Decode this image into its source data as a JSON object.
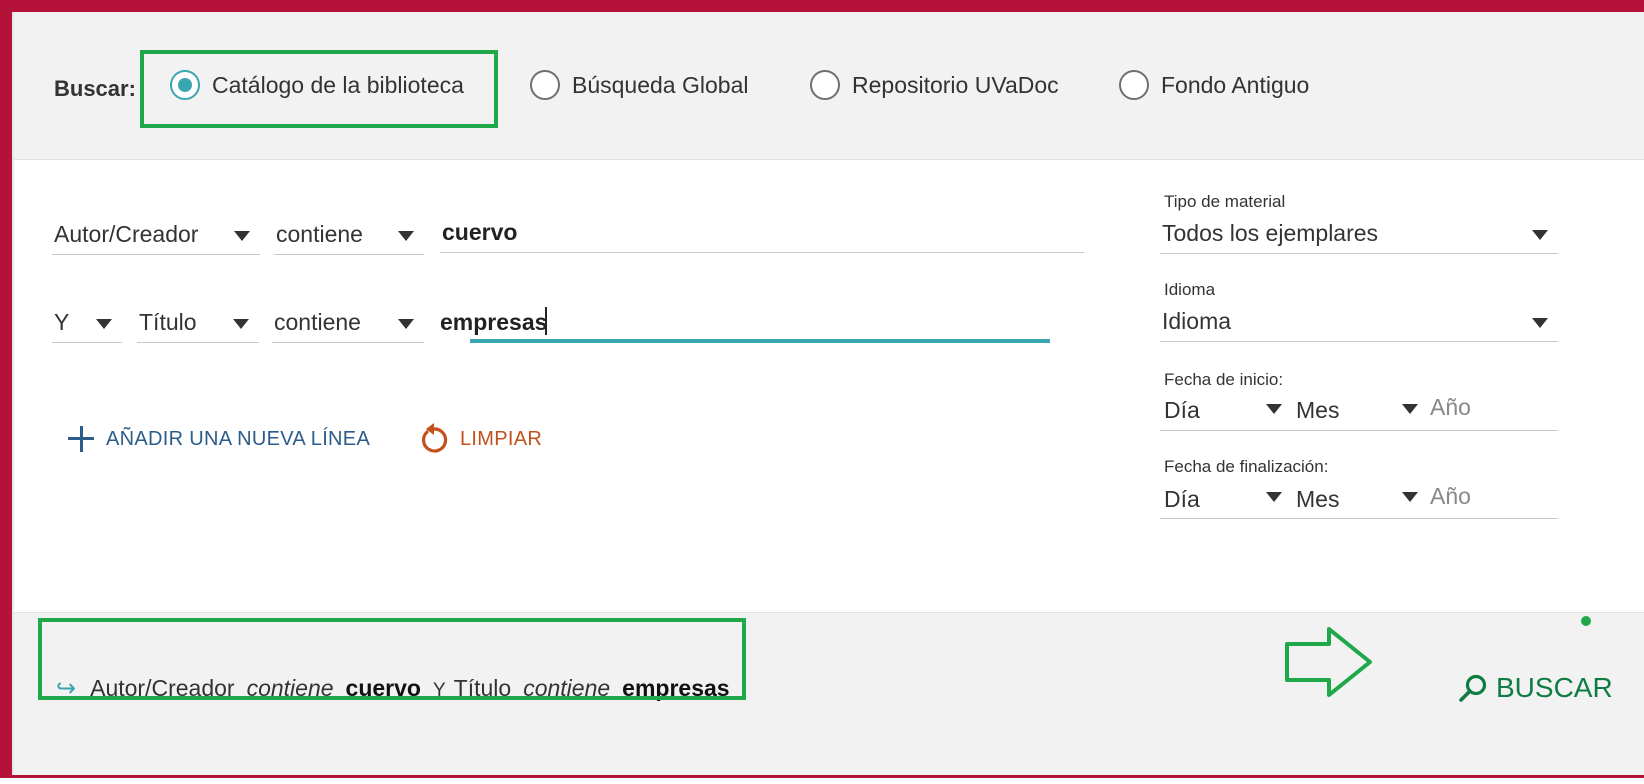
{
  "scope": {
    "label": "Buscar:",
    "options": [
      {
        "label": "Catálogo de la biblioteca",
        "selected": true
      },
      {
        "label": "Búsqueda Global",
        "selected": false
      },
      {
        "label": "Repositorio UVaDoc",
        "selected": false
      },
      {
        "label": "Fondo Antiguo",
        "selected": false
      }
    ]
  },
  "query_rows": [
    {
      "field": "Autor/Creador",
      "operator": "contiene",
      "value": "cuervo"
    },
    {
      "boolean": "Y",
      "field": "Título",
      "operator": "contiene",
      "value": "empresas"
    }
  ],
  "actions": {
    "add_line": "AÑADIR UNA NUEVA LÍNEA",
    "clear": "LIMPIAR"
  },
  "filters": {
    "material_type": {
      "label": "Tipo de material",
      "value": "Todos los ejemplares"
    },
    "language": {
      "label": "Idioma",
      "value": "Idioma"
    },
    "start_date": {
      "label": "Fecha de inicio:",
      "day": "Día",
      "month": "Mes",
      "year_placeholder": "Año"
    },
    "end_date": {
      "label": "Fecha de finalización:",
      "day": "Día",
      "month": "Mes",
      "year_placeholder": "Año"
    }
  },
  "summary": {
    "arrow": "↪",
    "field1": "Autor/Creador",
    "op1": "contiene",
    "val1": "cuervo",
    "boolean": "Y",
    "field2": "Título",
    "op2": "contiene",
    "val2": "empresas"
  },
  "search_button": {
    "label": "BUSCAR"
  },
  "colors": {
    "frame": "#b5123a",
    "accent": "#3aa6b0",
    "annotation": "#1fa84a",
    "link_blue": "#2c5d8a",
    "clear_orange": "#c4501c",
    "search_green": "#0f7d43"
  }
}
